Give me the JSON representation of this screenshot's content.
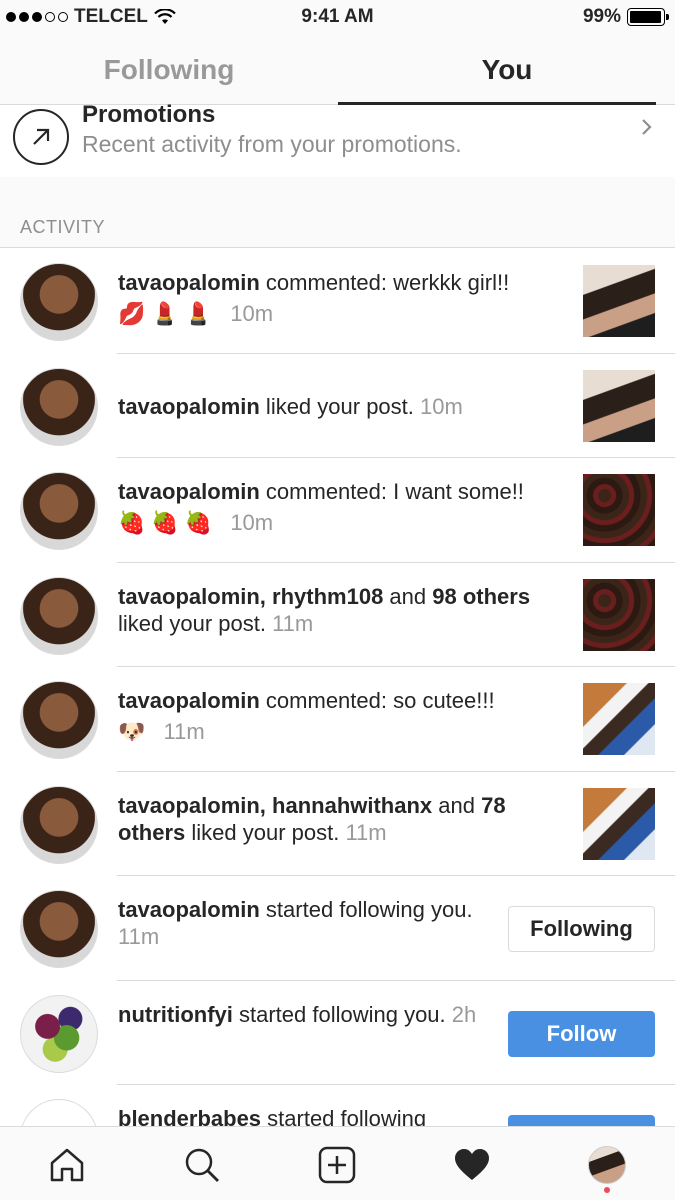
{
  "status_bar": {
    "carrier": "TELCEL",
    "time": "9:41 AM",
    "battery": "99%"
  },
  "tabs": {
    "following": "Following",
    "you": "You"
  },
  "promotions": {
    "title": "Promotions",
    "subtitle": "Recent activity from your promotions."
  },
  "section": {
    "label": "ACTIVITY"
  },
  "activity": [
    {
      "user": "tavaopalomin",
      "text": " commented: werkkk girl!!",
      "emojis": "💋💄💄",
      "time": "10m",
      "thumb": "portrait"
    },
    {
      "user": "tavaopalomin",
      "text": " liked your post. ",
      "time_inline": "10m",
      "thumb": "portrait"
    },
    {
      "user": "tavaopalomin",
      "text": " commented: I want some!!",
      "emojis": "🍓🍓🍓",
      "time": "10m",
      "thumb": "choco"
    },
    {
      "user": "tavaopalomin, rhythm108",
      "text_and": " and ",
      "bold2": "98 others",
      "text2": " liked your post. ",
      "time_inline": "11m",
      "thumb": "choco"
    },
    {
      "user": "tavaopalomin",
      "text": " commented: so cutee!!!",
      "emojis": "🐶",
      "time": "11m",
      "thumb": "dog"
    },
    {
      "user": "tavaopalomin, hannahwithanx",
      "text_and": " and ",
      "bold2": "78 others",
      "text2": " liked your post. ",
      "time_inline": "11m",
      "thumb": "dog"
    },
    {
      "user": "tavaopalomin",
      "text": " started following you. ",
      "time_inline": "11m",
      "button": "Following"
    },
    {
      "user": "nutritionfyi",
      "text": " started following you. ",
      "time_inline": "2h",
      "button": "Follow"
    },
    {
      "user": "blenderbabes",
      "text": " started following",
      "button": "Follow"
    }
  ],
  "icons": [
    "home-icon",
    "search-icon",
    "add-post-icon",
    "heart-icon",
    "profile-avatar"
  ]
}
